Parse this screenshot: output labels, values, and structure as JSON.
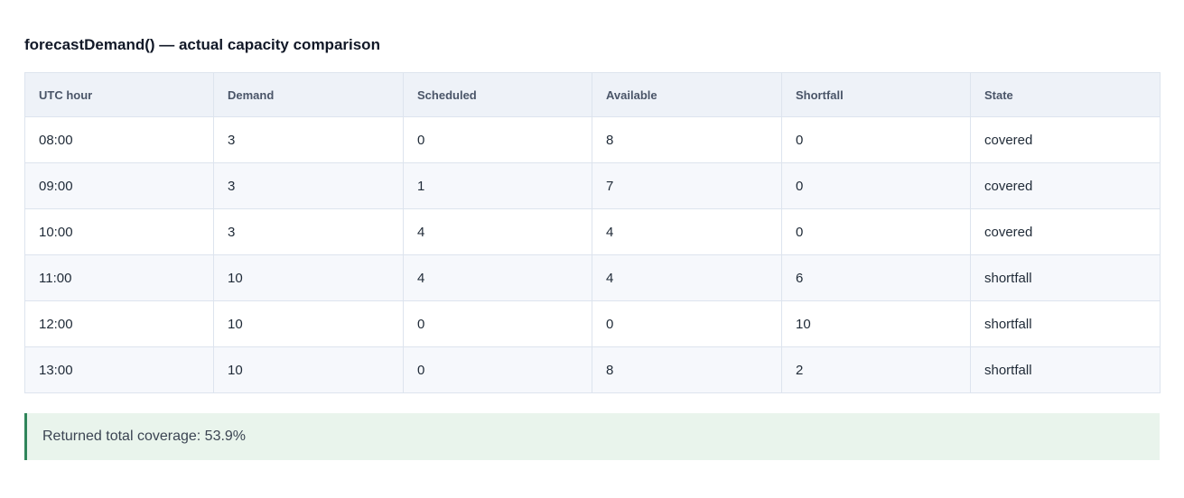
{
  "title": "forecastDemand() — actual capacity comparison",
  "table": {
    "columns": [
      "UTC hour",
      "Demand",
      "Scheduled",
      "Available",
      "Shortfall",
      "State"
    ],
    "rows": [
      [
        "08:00",
        "3",
        "0",
        "8",
        "0",
        "covered"
      ],
      [
        "09:00",
        "3",
        "1",
        "7",
        "0",
        "covered"
      ],
      [
        "10:00",
        "3",
        "4",
        "4",
        "0",
        "covered"
      ],
      [
        "11:00",
        "10",
        "4",
        "4",
        "6",
        "shortfall"
      ],
      [
        "12:00",
        "10",
        "0",
        "0",
        "10",
        "shortfall"
      ],
      [
        "13:00",
        "10",
        "0",
        "8",
        "2",
        "shortfall"
      ]
    ]
  },
  "summary": {
    "text": "Returned total coverage: 53.9%"
  },
  "colors": {
    "header_bg": "#eef2f8",
    "border": "#dde4ee",
    "summary_bg": "#e9f4ec",
    "summary_accent": "#2f855a"
  }
}
